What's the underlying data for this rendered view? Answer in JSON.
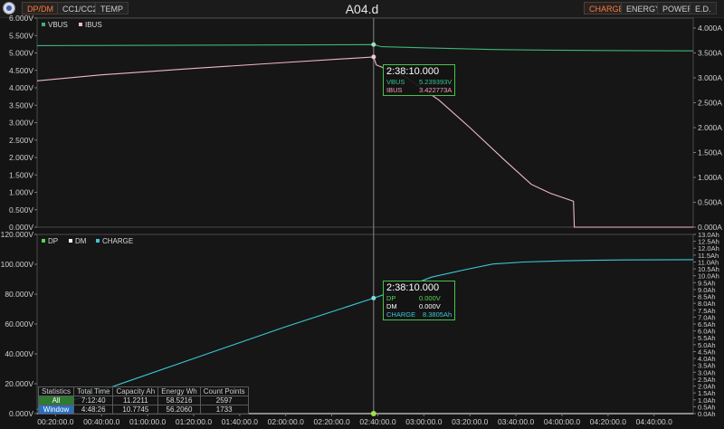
{
  "header": {
    "title": "A04.d",
    "left_tabs": [
      "DP/DM",
      "CC1/CC2",
      "TEMP"
    ],
    "right_tabs": [
      "CHARGE",
      "ENERGY",
      "POWER",
      "E.D."
    ]
  },
  "tooltips": [
    {
      "time": "2:38:10.000",
      "rows": [
        {
          "label": "VBUS",
          "value": "5.239393V",
          "color": "#39c48c"
        },
        {
          "label": "IBUS",
          "value": "3.422773A",
          "color": "#f0a0b0"
        }
      ]
    },
    {
      "time": "2:38:10.000",
      "rows": [
        {
          "label": "DP",
          "value": "0.000V",
          "color": "#55d655"
        },
        {
          "label": "DM",
          "value": "0.000V",
          "color": "#ffffff"
        },
        {
          "label": "CHARGE",
          "value": "8.3805Ah",
          "color": "#3cc8d8"
        }
      ]
    }
  ],
  "stats": {
    "headers": [
      "Statistics",
      "Total Time",
      "Capacity Ah",
      "Energy Wh",
      "Count Points"
    ],
    "rows": [
      {
        "label": "All",
        "values": [
          "7:12:40",
          "11.2211",
          "58.5216",
          "2597"
        ]
      },
      {
        "label": "Window",
        "values": [
          "4:48:26",
          "10.7745",
          "56.2060",
          "1733"
        ]
      }
    ]
  },
  "chart_data": [
    {
      "type": "line",
      "title": "",
      "x_unit": "seconds",
      "xlim": [
        720,
        17820
      ],
      "ylim": [
        0,
        6
      ],
      "y2lim": [
        0,
        4.2
      ],
      "ytick_labels": [
        "0.000V",
        "0.500V",
        "1.000V",
        "1.500V",
        "2.000V",
        "2.500V",
        "3.000V",
        "3.500V",
        "4.000V",
        "4.500V",
        "5.000V",
        "5.500V",
        "6.000V"
      ],
      "y2tick_labels": [
        "0.000A",
        "0.500A",
        "1.000A",
        "1.500A",
        "2.000A",
        "2.500A",
        "3.000A",
        "3.500A",
        "4.000A"
      ],
      "legend_position": "top-left",
      "grid": false,
      "series": [
        {
          "name": "VBUS",
          "axis": "left",
          "color": "#3fb37a",
          "x": [
            720,
            9490,
            9700,
            11000,
            12600,
            14000,
            15500,
            17820
          ],
          "y": [
            5.21,
            5.24,
            5.18,
            5.14,
            5.1,
            5.08,
            5.07,
            5.06
          ]
        },
        {
          "name": "IBUS",
          "axis": "right",
          "color": "#f0b8c8",
          "x": [
            720,
            2400,
            4800,
            7200,
            9490,
            9560,
            10300,
            11200,
            12000,
            12900,
            13600,
            14100,
            14400,
            14700,
            14720,
            17820
          ],
          "y": [
            2.94,
            3.06,
            3.19,
            3.31,
            3.42,
            3.26,
            3.03,
            2.55,
            2.0,
            1.35,
            0.86,
            0.68,
            0.6,
            0.52,
            0.0,
            0.0
          ]
        }
      ]
    },
    {
      "type": "line",
      "title": "",
      "x_unit": "seconds",
      "xlim": [
        720,
        17820
      ],
      "ylim": [
        0,
        120
      ],
      "y2lim": [
        0,
        13
      ],
      "ytick_labels": [
        "0.000V",
        "20.000V",
        "40.000V",
        "60.000V",
        "80.000V",
        "100.000V",
        "120.000V"
      ],
      "y2tick_labels": [
        "0.0Ah",
        "0.5Ah",
        "1.0Ah",
        "1.5Ah",
        "2.0Ah",
        "2.5Ah",
        "3.0Ah",
        "3.5Ah",
        "4.0Ah",
        "4.5Ah",
        "5.0Ah",
        "5.5Ah",
        "6.0Ah",
        "6.5Ah",
        "7.0Ah",
        "7.5Ah",
        "8.0Ah",
        "8.5Ah",
        "9.0Ah",
        "9.5Ah",
        "10.0Ah",
        "10.5Ah",
        "11.0Ah",
        "11.5Ah",
        "12.0Ah",
        "12.5Ah",
        "13.0Ah"
      ],
      "legend_position": "top-left",
      "grid": false,
      "x_tick_labels": [
        "00:20:00.0",
        "00:40:00.0",
        "01:00:00.0",
        "01:20:00.0",
        "01:40:00.0",
        "02:00:00.0",
        "02:20:00.0",
        "02:40:00.0",
        "03:00:00.0",
        "03:20:00.0",
        "03:40:00.0",
        "04:00:00.0",
        "04:20:00.0",
        "04:40:00.0"
      ],
      "x_tick_values": [
        1200,
        2400,
        3600,
        4800,
        6000,
        7200,
        8400,
        9600,
        10800,
        12000,
        13200,
        14400,
        15600,
        16800
      ],
      "series": [
        {
          "name": "DP",
          "axis": "left",
          "color": "#55d655",
          "x": [
            720,
            17820
          ],
          "y": [
            0,
            0
          ]
        },
        {
          "name": "DM",
          "axis": "left",
          "color": "#ffffff",
          "x": [
            720,
            17820
          ],
          "y": [
            0,
            0
          ]
        },
        {
          "name": "CHARGE",
          "axis": "right",
          "color": "#3cc8d8",
          "x": [
            720,
            1800,
            4800,
            7200,
            9490,
            10200,
            11000,
            11800,
            12600,
            13400,
            14400,
            15200,
            16000,
            17820
          ],
          "y": [
            0.3,
            1.1,
            4.0,
            6.3,
            8.38,
            9.05,
            9.9,
            10.4,
            10.85,
            11.0,
            11.08,
            11.12,
            11.15,
            11.17
          ]
        }
      ],
      "cursor_x": 9490
    }
  ]
}
